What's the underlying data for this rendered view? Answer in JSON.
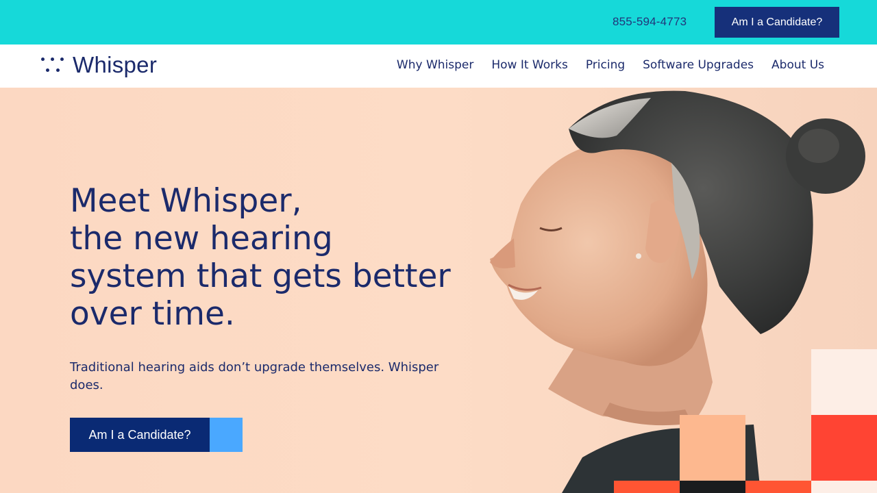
{
  "topbar": {
    "phone": "855-594-4773",
    "cta_label": "Am I a Candidate?"
  },
  "brand": {
    "name": "Whisper"
  },
  "nav": {
    "items": [
      "Why Whisper",
      "How It Works",
      "Pricing",
      "Software Upgrades",
      "About Us"
    ]
  },
  "hero": {
    "headline_lines": [
      "Meet Whisper,",
      "the new hearing",
      "system that gets better",
      "over time."
    ],
    "subtitle": "Traditional hearing aids don’t upgrade themselves. Whisper does.",
    "cta_label": "Am I a Candidate?",
    "photo_icon": "woman-profile-photo"
  },
  "colors": {
    "topbar": "#16d9d9",
    "navy": "#1b2a6b",
    "button": "#0a2a74",
    "accent_blue": "#4aa8ff",
    "hero_bg": "#fcdcc4",
    "block_peach": "#fdb88f",
    "block_red": "#ff4433",
    "block_cream": "#fdeee6",
    "block_orange": "#ff5533"
  }
}
